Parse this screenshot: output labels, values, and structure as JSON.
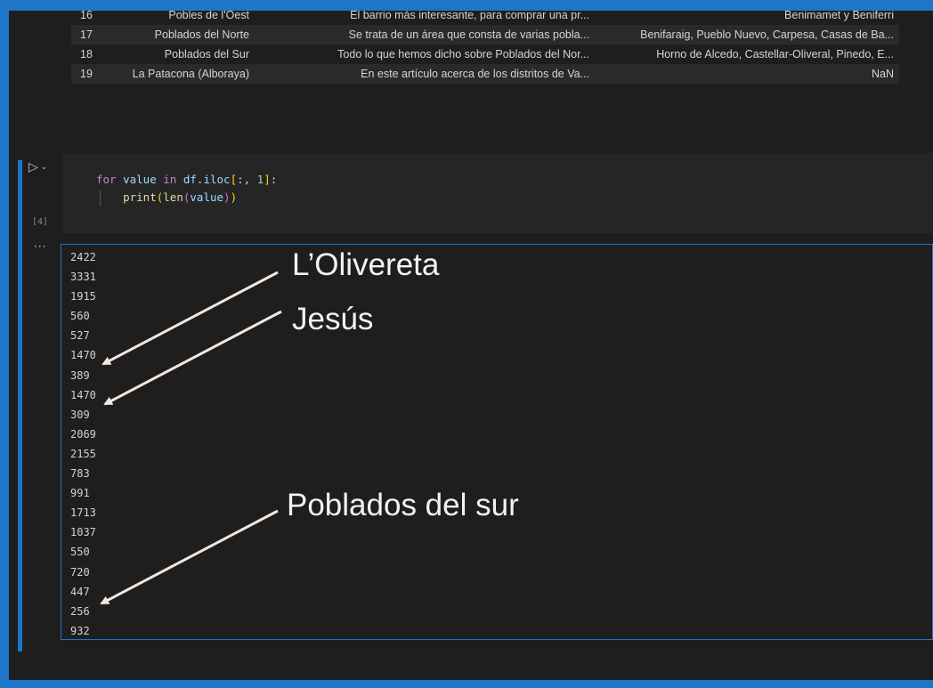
{
  "table": {
    "rows": [
      {
        "index": "16",
        "name": "Pobles de l'Oest",
        "description": "El barrio más interesante, para comprar una pr...",
        "barrios": "Benimamet y Beniferri"
      },
      {
        "index": "17",
        "name": "Poblados del Norte",
        "description": "Se trata de un área que consta de varias pobla...",
        "barrios": "Benifaraig, Pueblo Nuevo, Carpesa, Casas de Ba..."
      },
      {
        "index": "18",
        "name": "Poblados del Sur",
        "description": "Todo lo que hemos dicho sobre Poblados del Nor...",
        "barrios": "Horno de Alcedo, Castellar-Oliveral, Pinedo, E..."
      },
      {
        "index": "19",
        "name": "La Patacona (Alboraya)",
        "description": "En este artículo acerca de los distritos de Va...",
        "barrios": "NaN"
      }
    ]
  },
  "cell": {
    "execution_count": "[4]",
    "code_line1": {
      "kw": "for",
      "var": "value",
      "in": "in",
      "obj": "df.iloc",
      "br_open": "[",
      "slice": ":, ",
      "num": "1",
      "br_close": "]",
      "colon": ":"
    },
    "code_line2": {
      "fn": "print",
      "p1": "(",
      "fn2": "len",
      "p2": "(",
      "arg": "value",
      "p3": ")",
      "p4": ")"
    },
    "more_label": "···"
  },
  "output": {
    "values": [
      "2422",
      "3331",
      "1915",
      "560",
      "527",
      "1470",
      "389",
      "1470",
      "309",
      "2069",
      "2155",
      "783",
      "991",
      "1713",
      "1037",
      "550",
      "720",
      "447",
      "256",
      "932"
    ]
  },
  "annotations": {
    "label1": "L’Olivereta",
    "label2": "Jesús",
    "label3": "Poblados del sur",
    "arrow_color": "#f5e6dc"
  }
}
